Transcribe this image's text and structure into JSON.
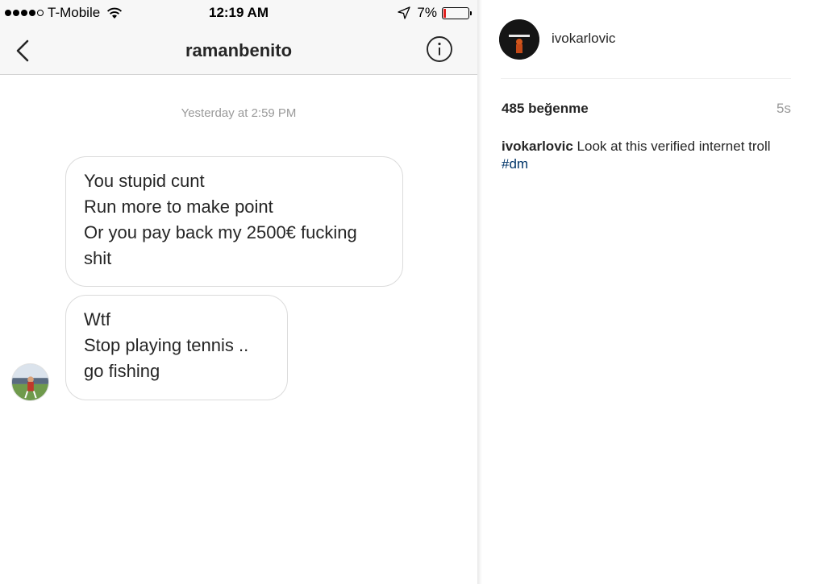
{
  "status_bar": {
    "carrier": "T-Mobile",
    "time": "12:19 AM",
    "battery": "7%",
    "signal_icon": "signal-dots-icon",
    "wifi_icon": "wifi-icon",
    "location_icon": "location-arrow-icon",
    "battery_icon": "battery-low-icon",
    "battery_level": 0.07,
    "battery_color": "#e0201f"
  },
  "nav": {
    "title": "ramanbenito",
    "back_icon": "chevron-left-icon",
    "info_icon": "info-icon"
  },
  "thread": {
    "timestamp": "Yesterday at 2:59 PM",
    "messages": [
      {
        "text": "You stupid cunt\nRun more to make point\nOr you pay back my 2500€ fucking\nshit"
      },
      {
        "text": "Wtf\nStop playing tennis ..\ngo fishing"
      }
    ]
  },
  "post": {
    "username": "ivokarlovic",
    "likes": "485 beğenme",
    "time_ago": "5s",
    "caption": {
      "user": "ivokarlovic",
      "text": " Look at this verified internet troll ",
      "hashtag": "#dm"
    },
    "hashtag_color": "#003569"
  }
}
